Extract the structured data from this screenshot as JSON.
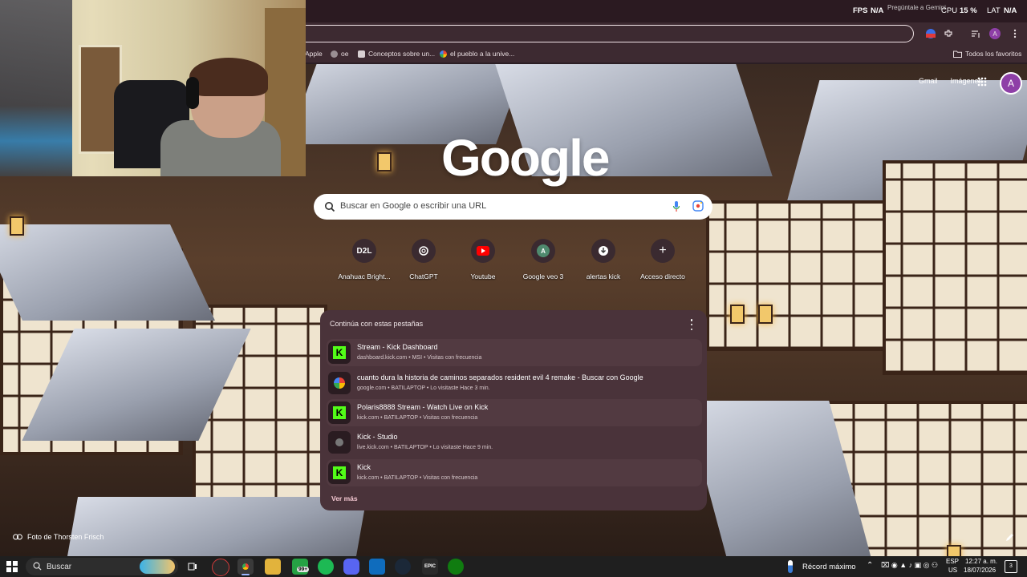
{
  "overlay": {
    "fps_label": "FPS",
    "fps_value": "N/A",
    "gpu_hint": "Pregúntale a Gemini",
    "cpu_label": "CPU",
    "cpu_value": "15 %",
    "lat_label": "LAT",
    "lat_value": "N/A"
  },
  "bookmarks": {
    "items": [
      "Apple",
      "oe",
      "Conceptos sobre un...",
      "el pueblo a la unive..."
    ],
    "all_label": "Todos los favoritos"
  },
  "profile": {
    "initial": "A"
  },
  "ntp": {
    "links": [
      "Gmail",
      "Imágenes"
    ],
    "logo": "Google",
    "search_placeholder": "Buscar en Google o escribir una URL",
    "shortcuts": [
      {
        "label": "Anahuac Bright...",
        "icon": "D2L"
      },
      {
        "label": "ChatGPT",
        "icon": "chatgpt-icon"
      },
      {
        "label": "Youtube",
        "icon": "youtube-icon"
      },
      {
        "label": "Google veo 3",
        "icon": "A"
      },
      {
        "label": "alertas kick",
        "icon": "alert-icon"
      },
      {
        "label": "Acceso directo",
        "icon": "+"
      }
    ],
    "tabs_card": {
      "title": "Continúa con estas pestañas",
      "items": [
        {
          "title": "Stream - Kick Dashboard",
          "meta": "dashboard.kick.com • MSI • Visitas con frecuencia",
          "favicon": "kick"
        },
        {
          "title": "cuanto dura la historia de caminos separados resident evil 4 remake - Buscar con Google",
          "meta": "google.com • BATILAPTOP • Lo visitaste Hace 3 min.",
          "favicon": "google"
        },
        {
          "title": "Polaris8888 Stream - Watch Live on Kick",
          "meta": "kick.com • BATILAPTOP • Visitas con frecuencia",
          "favicon": "kick"
        },
        {
          "title": "Kick - Studio",
          "meta": "live.kick.com • BATILAPTOP • Lo visitaste Hace 9 min.",
          "favicon": "globe"
        },
        {
          "title": "Kick",
          "meta": "kick.com • BATILAPTOP • Visitas con frecuencia",
          "favicon": "kick"
        }
      ],
      "more_label": "Ver más"
    },
    "photo_credit": "Foto de Thorsten Frisch"
  },
  "taskbar": {
    "search_label": "Buscar",
    "notifications_badge": "99+",
    "weather_text": "Récord máximo",
    "language": "ESP",
    "region": "US",
    "time": "12:27 a. m.",
    "date": "18/07/2026",
    "notification_count": "3"
  },
  "colors": {
    "ntp_card": "#4a333a",
    "kick_green": "#53fc18",
    "avatar": "#8e3fa7"
  }
}
